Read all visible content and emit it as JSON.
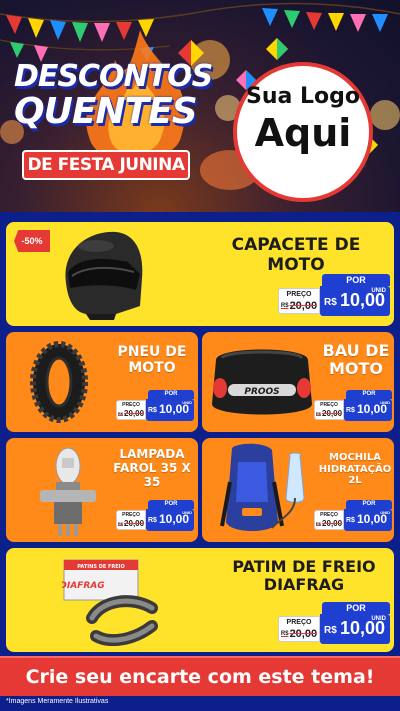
{
  "header": {
    "title_line1": "DESCONTOS",
    "title_line2": "QUENTES",
    "subtitle": "DE FESTA JUNINA",
    "logo_line1": "Sua Logo",
    "logo_line2": "Aqui"
  },
  "products": [
    {
      "name": "CAPACETE DE MOTO",
      "badge": "-50%",
      "old_label": "PREÇO",
      "old_price": "20,00",
      "por": "POR",
      "currency": "R$",
      "price": "10,00",
      "unit": "UNID",
      "old_currency": "R$"
    },
    {
      "name": "PNEU DE MOTO",
      "old_label": "PREÇO",
      "old_price": "20,00",
      "por": "POR",
      "currency": "R$",
      "price": "10,00",
      "unit": "UNID",
      "old_currency": "R$"
    },
    {
      "name": "BAU DE MOTO",
      "old_label": "PREÇO",
      "old_price": "20,00",
      "por": "POR",
      "currency": "R$",
      "price": "10,00",
      "unit": "UNID",
      "old_currency": "R$"
    },
    {
      "name": "LAMPADA FAROL 35 X 35",
      "old_label": "PREÇO",
      "old_price": "20,00",
      "por": "POR",
      "currency": "R$",
      "price": "10,00",
      "unit": "UNID",
      "old_currency": "R$"
    },
    {
      "name": "MOCHILA HIDRATAÇÃO 2L",
      "old_label": "PREÇO",
      "old_price": "20,00",
      "por": "POR",
      "currency": "R$",
      "price": "10,00",
      "unit": "UNID",
      "old_currency": "R$"
    },
    {
      "name": "PATIM DE FREIO DIAFRAG",
      "old_label": "PREÇO",
      "old_price": "20,00",
      "por": "POR",
      "currency": "R$",
      "price": "10,00",
      "unit": "UNID",
      "old_currency": "R$"
    }
  ],
  "images": {
    "bau_brand": "PROOS",
    "patim_box_title": "PATINS DE FREIO",
    "patim_brand": "DIAFRAG"
  },
  "cta": {
    "label": "Crie seu encarte com este tema!"
  },
  "footnote": "*Imagens Meramente Ilustrativas",
  "colors": {
    "yellow": "#ffe22a",
    "orange": "#ff8a1a",
    "blue": "#1f3fd0",
    "red": "#e53935",
    "background": "#0d1f8a"
  }
}
